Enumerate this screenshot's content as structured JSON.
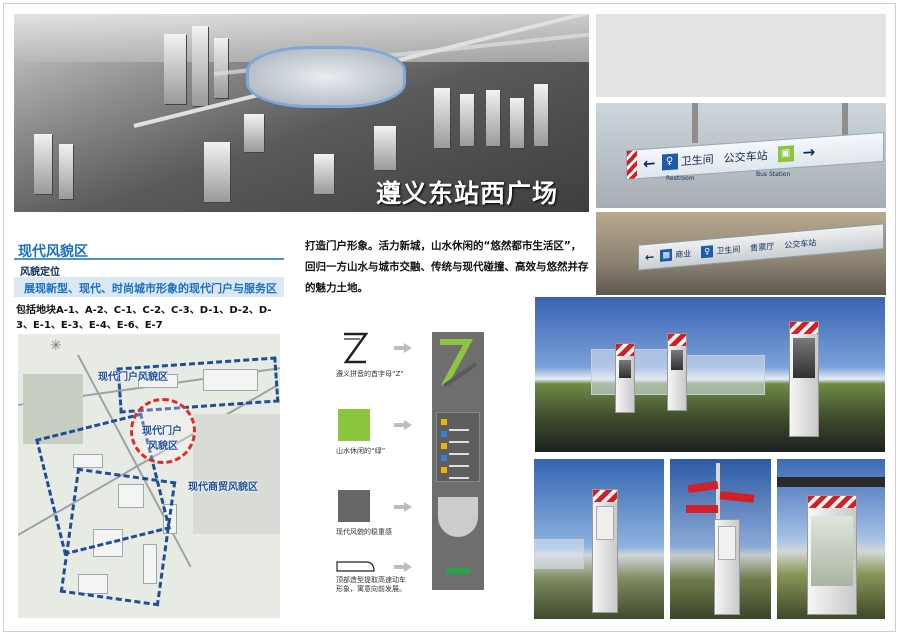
{
  "hero": {
    "title": "遵义东站西广场"
  },
  "signs": {
    "board1": {
      "restroom_label": "卫生间",
      "restroom_sub": "Restroom",
      "bus_label": "公交车站",
      "bus_sub": "Bus Station"
    },
    "board2": {
      "shop_label": "商业",
      "restroom_label": "卫生间",
      "ticket_label": "售票厅",
      "bus_label": "公交车站"
    }
  },
  "section": {
    "title": "现代风貌区",
    "subtitle": "风貌定位",
    "positioning": "展现新型、现代、时尚城市形象的现代门户与服务区",
    "blocks": "包括地块A-1、A-2、C-1、C-2、C-3、D-1、D-2、D-3、E-1、E-3、E-4、E-6、E-7"
  },
  "intro": "打造门户形象。活力新城，山水休闲的“悠然都市生活区”，回归一方山水与城市交融、传统与现代碰撞、高效与悠然并存的魅力土地。",
  "map": {
    "labels": {
      "gate_zone": "现代门户风貌区",
      "gate_center_1": "现代门户",
      "gate_center_2": "风貌区",
      "trade_zone": "现代商贸风貌区"
    },
    "colors": {
      "zone_border": "#1f4e95",
      "circle": "#e02b2b"
    }
  },
  "legend": [
    {
      "icon": "letter-z-icon",
      "text": "遵义拼音的首字母“Z”"
    },
    {
      "icon": "green-square-icon",
      "text": "山水休闲的“绿”",
      "color": "#8cc63f"
    },
    {
      "icon": "gray-square-icon",
      "text": "现代风貌的稳重感",
      "color": "#666666"
    },
    {
      "icon": "rounded-cap-icon",
      "text": "顶部造型提取高速动车形象，寓意向前发展。"
    }
  ],
  "colors": {
    "accent": "#1a6fc0",
    "highlight_bg": "#dbe8f4",
    "brand_red": "#d32027",
    "brand_green": "#8cc63f"
  }
}
